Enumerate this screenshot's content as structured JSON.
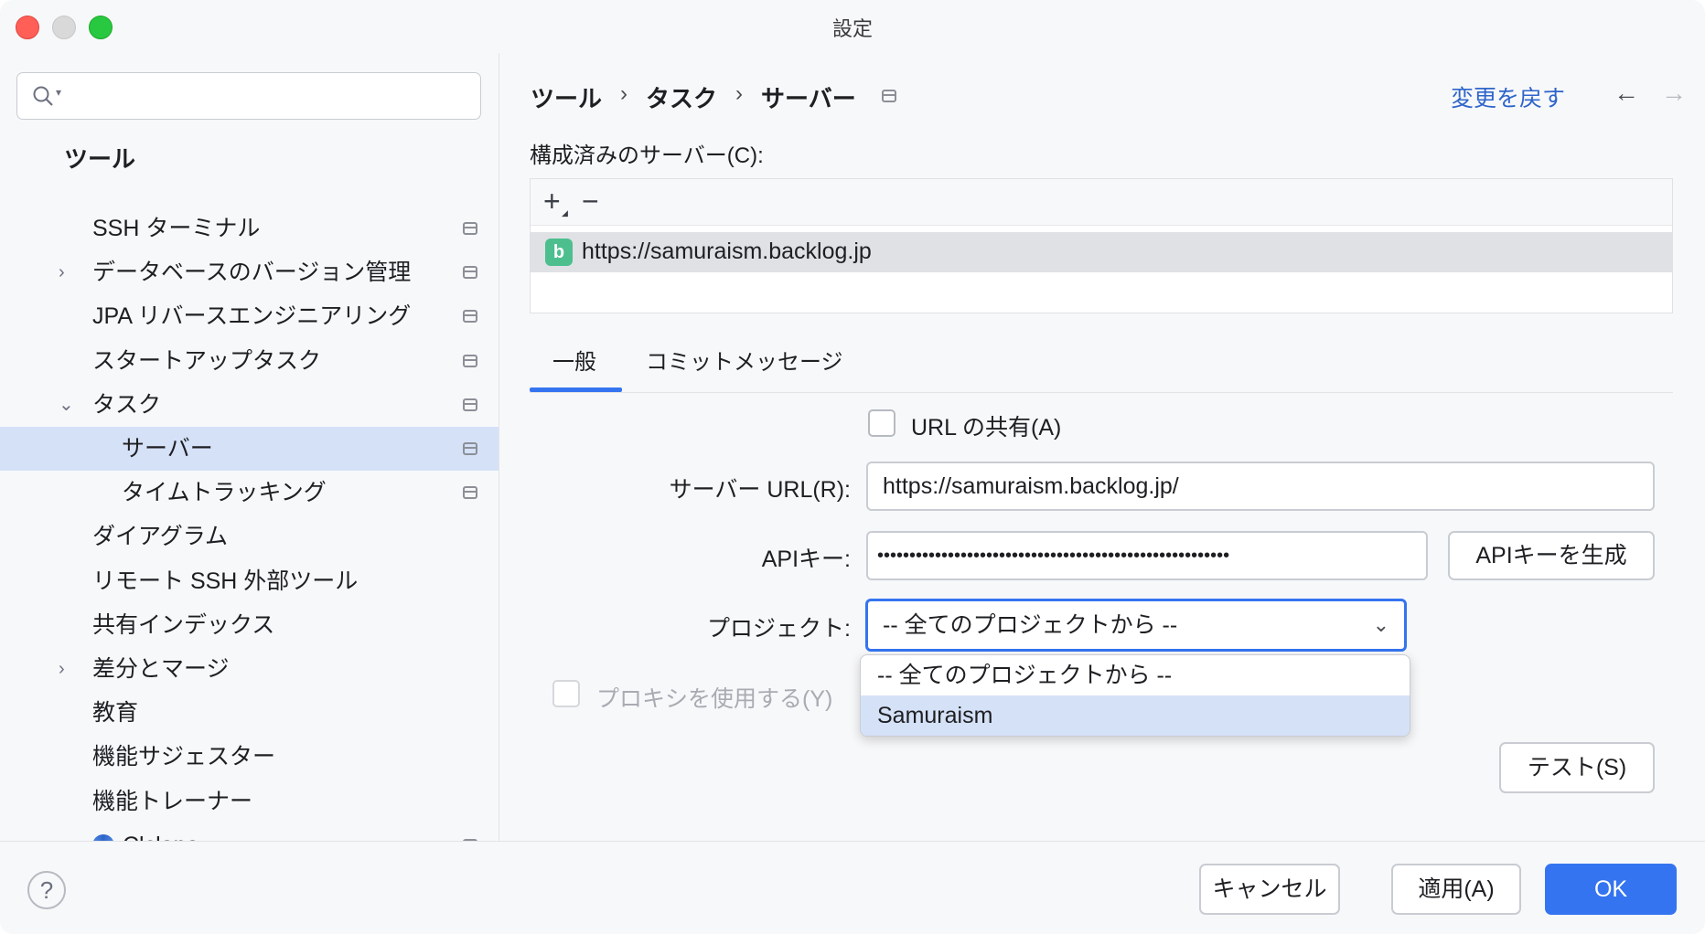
{
  "window": {
    "title": "設定"
  },
  "sidebar": {
    "search_placeholder": "",
    "heading": "ツール",
    "items": [
      {
        "label": "SSH ターミナル",
        "expander": "",
        "project_icon": true
      },
      {
        "label": "データベースのバージョン管理",
        "expander": "›",
        "project_icon": true
      },
      {
        "label": "JPA リバースエンジニアリング",
        "expander": "",
        "project_icon": true
      },
      {
        "label": "スタートアップタスク",
        "expander": "",
        "project_icon": true
      },
      {
        "label": "タスク",
        "expander": "⌄",
        "project_icon": true
      },
      {
        "label": "サーバー",
        "expander": "",
        "project_icon": true,
        "selected": true
      },
      {
        "label": "タイムトラッキング",
        "expander": "",
        "project_icon": true
      },
      {
        "label": "ダイアグラム",
        "expander": "",
        "project_icon": false
      },
      {
        "label": "リモート SSH 外部ツール",
        "expander": "",
        "project_icon": false
      },
      {
        "label": "共有インデックス",
        "expander": "",
        "project_icon": false
      },
      {
        "label": "差分とマージ",
        "expander": "›",
        "project_icon": false
      },
      {
        "label": "教育",
        "expander": "",
        "project_icon": false
      },
      {
        "label": "機能サジェスター",
        "expander": "",
        "project_icon": false
      },
      {
        "label": "機能トレーナー",
        "expander": "",
        "project_icon": false
      },
      {
        "label": "Clclone",
        "expander": "›",
        "project_icon": true,
        "icon": "spiral-icon"
      }
    ]
  },
  "breadcrumb": [
    "ツール",
    "タスク",
    "サーバー"
  ],
  "breadcrumb_sep": "›",
  "header": {
    "revert_label": "変更を戻す",
    "back": "←",
    "forward": "→"
  },
  "servers": {
    "label": "構成済みのサーバー(C):",
    "add": "+",
    "remove": "−",
    "list": [
      {
        "url": "https://samuraism.backlog.jp",
        "icon_letter": "b"
      }
    ]
  },
  "tabs": [
    {
      "label": "一般",
      "active": true
    },
    {
      "label": "コミットメッセージ",
      "active": false
    }
  ],
  "form": {
    "share_url_label": "URL の共有(A)",
    "server_url_label": "サーバー URL(R):",
    "server_url_value": "https://samuraism.backlog.jp/",
    "api_key_label": "APIキー:",
    "api_key_value": "•••••••••••••••••••••••••••••••••••••••••••••••••••••••",
    "generate_label": "APIキーを生成",
    "project_label": "プロジェクト:",
    "project_value": "-- 全てのプロジェクトから --",
    "project_options": [
      "-- 全てのプロジェクトから --",
      "Samuraism"
    ],
    "proxy_label": "プロキシを使用する(Y)",
    "test_label": "テスト(S)"
  },
  "footer": {
    "help": "?",
    "cancel": "キャンセル",
    "apply": "適用(A)",
    "ok": "OK"
  },
  "colors": {
    "accent": "#3574f0",
    "selection": "#d5e1f7",
    "link": "#2f65ca"
  }
}
